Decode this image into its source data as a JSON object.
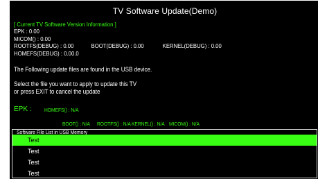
{
  "window": {
    "title": "TV Software Update(Demo)"
  },
  "version_info": {
    "header": "[ Current TV Software Version Information ]",
    "epk": "EPK : 0.00",
    "micom": "MICOM() : 0.00",
    "rootfs": "ROOTFS(DEBUG) : 0.00",
    "boot": "BOOT(DEBUG) : 0.00",
    "kernel": "KERNEL(DEBUG) : 0.00",
    "homefs": "HOMEFS(DEBUG) : 0.00.0"
  },
  "messages": {
    "found": "The Following update files are found in the USB device.",
    "select_line1": "Select the file you want to apply to update  this TV",
    "select_line2": "or press EXIT to cancel the update"
  },
  "update_files": {
    "epk_label": "EPK :",
    "homefs": "HOMEFS() : N/A",
    "boot": "BOOT() : N/A",
    "rootfs": "ROOTFS() : N/A",
    "kernel": "KERNEL() : N/A",
    "micom": "MICOM() : N/A"
  },
  "file_list": {
    "header": "Software File List in USB Memory",
    "items": [
      "Test",
      "Test",
      "Test",
      "Test"
    ],
    "selected_index": 0
  },
  "colors": {
    "background": "#000000",
    "highlight": "#39ff14",
    "text": "#ffffff"
  }
}
